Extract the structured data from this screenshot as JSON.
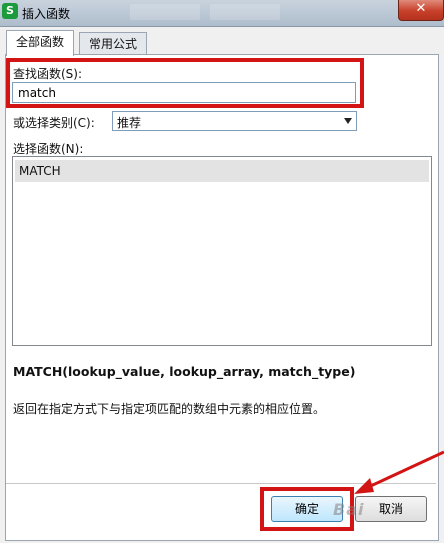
{
  "window": {
    "title": "插入函数",
    "app_icon_letter": "S",
    "close_glyph": "✕"
  },
  "tabs": [
    {
      "label": "全部函数",
      "active": true
    },
    {
      "label": "常用公式",
      "active": false
    }
  ],
  "search": {
    "label": "查找函数(S):",
    "value": "match"
  },
  "category": {
    "label": "或选择类别(C):",
    "selected": "推荐"
  },
  "function_list": {
    "label": "选择函数(N):",
    "items": [
      "MATCH"
    ]
  },
  "details": {
    "signature": "MATCH(lookup_value, lookup_array, match_type)",
    "description": "返回在指定方式下与指定项匹配的数组中元素的相应位置。"
  },
  "buttons": {
    "ok": "确定",
    "cancel": "取消"
  },
  "watermark": "Bai",
  "colors": {
    "highlight_red": "#d21414",
    "list_selection": "#e3e3e3"
  }
}
